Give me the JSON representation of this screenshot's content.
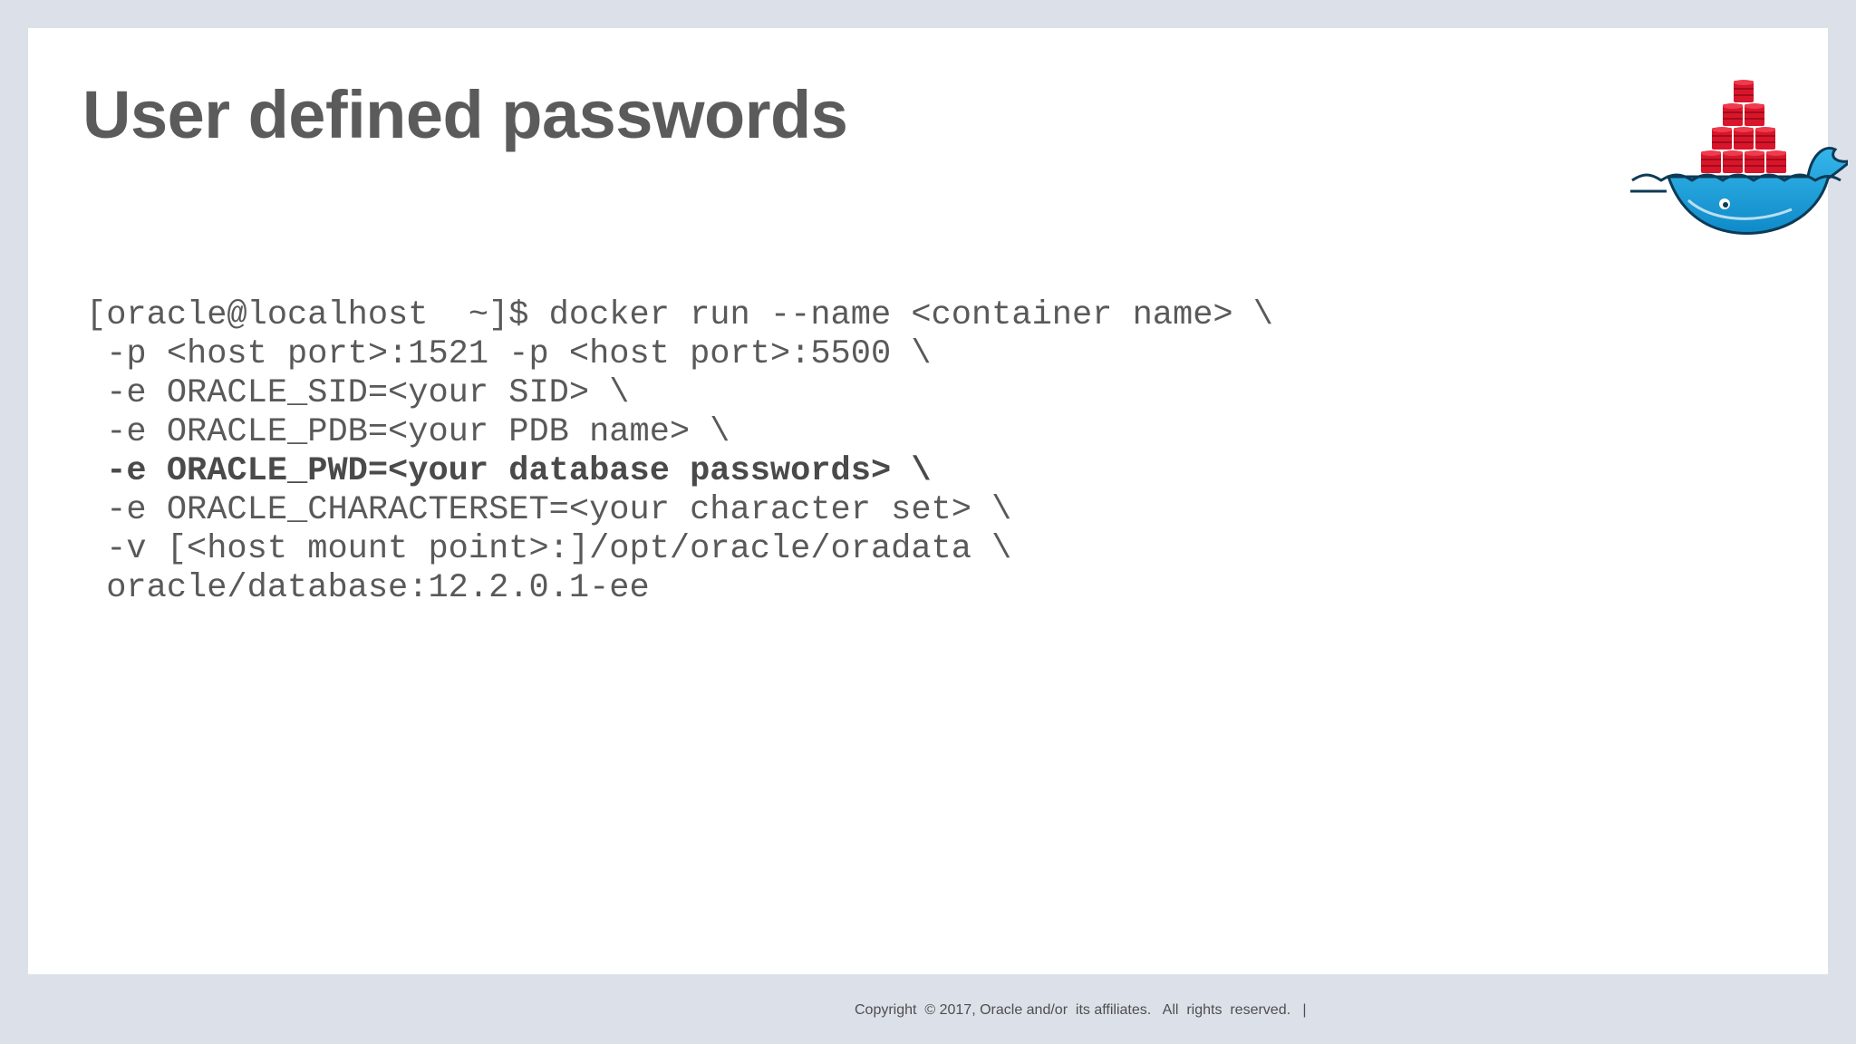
{
  "slide": {
    "title": "User defined passwords",
    "logo_icon": "docker-whale-icon",
    "code_lines": [
      {
        "text": "[oracle@localhost  ~]$ docker run --name <container name> \\",
        "bold": false
      },
      {
        "text": " -p <host port>:1521 -p <host port>:5500 \\",
        "bold": false
      },
      {
        "text": " -e ORACLE_SID=<your SID> \\",
        "bold": false
      },
      {
        "text": " -e ORACLE_PDB=<your PDB name> \\",
        "bold": false
      },
      {
        "text": " -e ORACLE_PWD=<your database passwords> \\",
        "bold": true
      },
      {
        "text": " -e ORACLE_CHARACTERSET=<your character set> \\",
        "bold": false
      },
      {
        "text": " -v [<host mount point>:]/opt/oracle/oradata \\",
        "bold": false
      },
      {
        "text": " oracle/database:12.2.0.1-ee",
        "bold": false
      }
    ]
  },
  "footer": {
    "copyright": "Copyright  © 2017, Oracle and/or  its affiliates.   All  rights  reserved.   |"
  },
  "colors": {
    "background": "#dce1e9",
    "slide": "#ffffff",
    "title": "#5b5b5b",
    "code": "#595959",
    "docker_red": "#d8152a",
    "docker_blue": "#1d9bd7",
    "docker_dark": "#0d3b57"
  }
}
